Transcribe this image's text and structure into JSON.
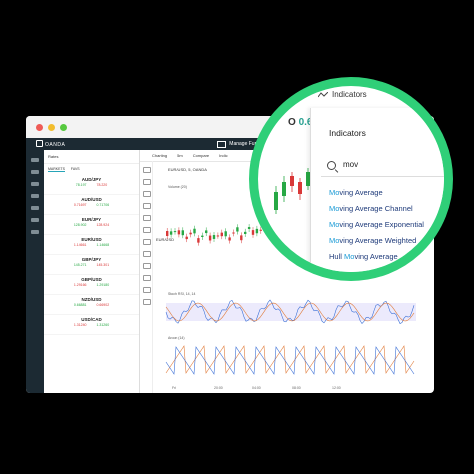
{
  "app": {
    "brand": "OANDA",
    "manage_funds": "Manage Funds"
  },
  "watchlist": {
    "header": "Rates",
    "tabs": [
      "MARKETS",
      "FAVS"
    ],
    "pairs": [
      {
        "name": "AUD/JPY",
        "bid": "78.197",
        "ask": "78.220"
      },
      {
        "name": "AUD/USD",
        "bid": "0.71697",
        "ask": "0.71706"
      },
      {
        "name": "EUR/JPY",
        "bid": "128.902",
        "ask": "128.924"
      },
      {
        "name": "EUR/USD",
        "bid": "1.14661",
        "ask": "1.14668"
      },
      {
        "name": "GBP/JPY",
        "bid": "145.271",
        "ask": "145.301"
      },
      {
        "name": "GBP/USD",
        "bid": "1.29166",
        "ask": "1.29180"
      },
      {
        "name": "NZD/USD",
        "bid": "0.66881",
        "ask": "0.66902"
      },
      {
        "name": "USD/CAD",
        "bid": "1.31240",
        "ask": "1.31260"
      }
    ]
  },
  "chart_toolbar": {
    "tab": "Charting",
    "interval": "5m",
    "compare": "Compare",
    "indicators": "Indic"
  },
  "chart": {
    "symbol": "EUR/USD, 5, OANDA",
    "symbol_short": "EUR/USD",
    "volume_label": "Volume (20)",
    "stoch_label": "Stoch RSI, 14, 14",
    "aroon_label": "Aroon (14)",
    "time_labels": [
      "Fri",
      "20:00",
      "04:00",
      "08:00",
      "12:00"
    ]
  },
  "magnifier": {
    "price_prefix": "O",
    "price": "0.688",
    "indicators_button": "Indicators",
    "panel_title": "Indicators",
    "search_query": "mov",
    "results": [
      {
        "match": "Mo",
        "pre": "",
        "rest": "ving Average"
      },
      {
        "match": "Mo",
        "pre": "",
        "rest": "ving Average Channel"
      },
      {
        "match": "Mo",
        "pre": "",
        "rest": "ving Average Exponential"
      },
      {
        "match": "Mo",
        "pre": "",
        "rest": "ving Average Weighted"
      },
      {
        "match": "Mo",
        "pre": "Hull ",
        "rest": "ving Average"
      }
    ]
  },
  "colors": {
    "accent": "#2fcf78",
    "match": "#1a9bd6",
    "up": "#27a844",
    "down": "#d93838"
  }
}
